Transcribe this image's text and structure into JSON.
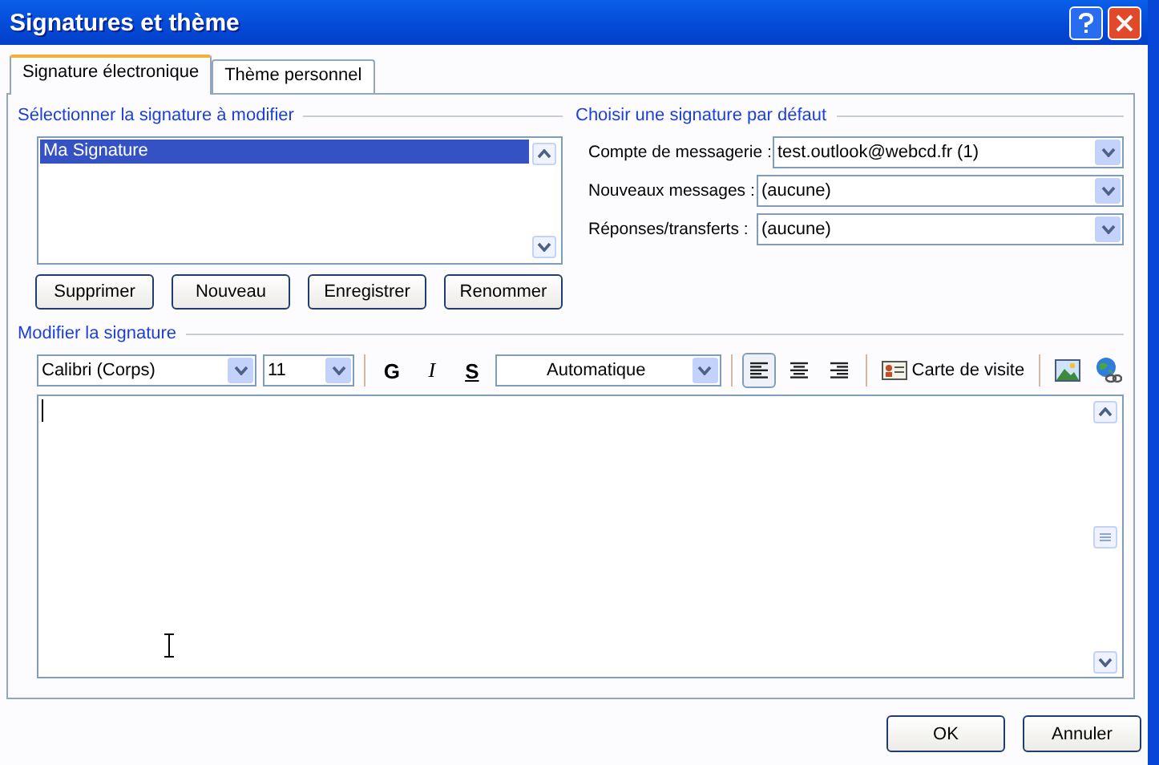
{
  "window": {
    "title": "Signatures et thème"
  },
  "tabs": [
    {
      "label": "Signature électronique",
      "selected": true
    },
    {
      "label": "Thème personnel",
      "selected": false
    }
  ],
  "select_section": {
    "title": "Sélectionner la signature à modifier",
    "signatures": [
      {
        "label": "Ma Signature",
        "selected": true
      }
    ],
    "buttons": [
      "Supprimer",
      "Nouveau",
      "Enregistrer",
      "Renommer"
    ]
  },
  "default_section": {
    "title": "Choisir une signature par défaut",
    "fields": [
      {
        "label": "Compte de messagerie :",
        "value": "test.outlook@webcd.fr (1)"
      },
      {
        "label": "Nouveaux messages :",
        "value": "(aucune)"
      },
      {
        "label": "Réponses/transferts :",
        "value": "(aucune)"
      }
    ]
  },
  "edit_section": {
    "title": "Modifier la signature",
    "font": "Calibri (Corps)",
    "size": "11",
    "format_buttons": [
      {
        "label": "G",
        "kind": "bold"
      },
      {
        "label": "I",
        "kind": "italic"
      },
      {
        "label": "S",
        "kind": "underline"
      }
    ],
    "color_choice": "Automatique",
    "align_buttons": [
      {
        "kind": "left",
        "selected": true
      },
      {
        "kind": "center",
        "selected": false
      },
      {
        "kind": "right",
        "selected": false
      }
    ],
    "card_button": "Carte de visite"
  },
  "buttons": [
    "OK",
    "Annuler"
  ]
}
